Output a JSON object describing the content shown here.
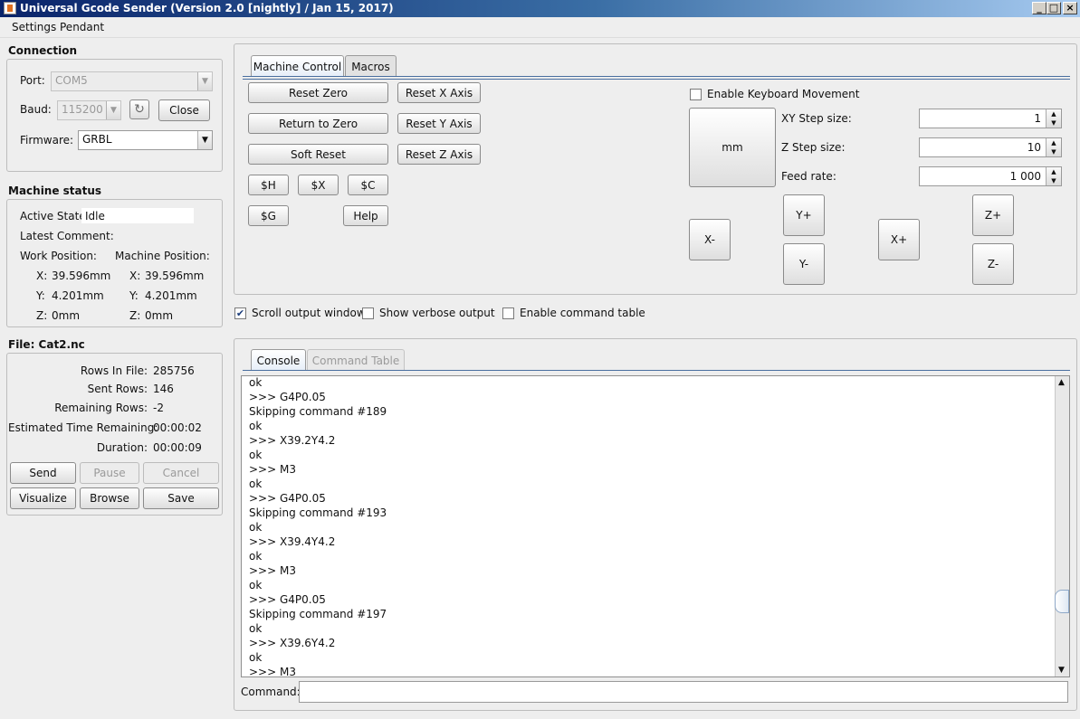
{
  "window": {
    "title": "Universal Gcode Sender (Version 2.0 [nightly]  / Jan 15, 2017)"
  },
  "menu": [
    "Settings",
    "Pendant"
  ],
  "connection": {
    "title": "Connection",
    "port_label": "Port:",
    "port_value": "COM5",
    "baud_label": "Baud:",
    "baud_value": "115200",
    "close_label": "Close",
    "firmware_label": "Firmware:",
    "firmware_value": "GRBL"
  },
  "machine_status": {
    "title": "Machine status",
    "active_state_label": "Active State:",
    "active_state_value": "Idle",
    "latest_comment_label": "Latest Comment:",
    "work_position_label": "Work Position:",
    "machine_position_label": "Machine Position:",
    "work": {
      "x_label": "X:",
      "x": "39.596mm",
      "y_label": "Y:",
      "y": "4.201mm",
      "z_label": "Z:",
      "z": "0mm"
    },
    "machine": {
      "x_label": "X:",
      "x": "39.596mm",
      "y_label": "Y:",
      "y": "4.201mm",
      "z_label": "Z:",
      "z": "0mm"
    }
  },
  "file": {
    "title": "File: Cat2.nc",
    "rows_in_file_label": "Rows In File:",
    "rows_in_file": "285756",
    "sent_rows_label": "Sent Rows:",
    "sent_rows": "146",
    "remaining_rows_label": "Remaining Rows:",
    "remaining_rows": "-2",
    "est_time_label": "Estimated Time Remaining:",
    "est_time": "00:00:02",
    "duration_label": "Duration:",
    "duration": "00:00:09",
    "buttons": {
      "send": "Send",
      "pause": "Pause",
      "cancel": "Cancel",
      "visualize": "Visualize",
      "browse": "Browse",
      "save": "Save"
    }
  },
  "control_tabs": {
    "machine_control": "Machine Control",
    "macros": "Macros"
  },
  "machine_control": {
    "reset_zero": "Reset Zero",
    "return_to_zero": "Return to Zero",
    "soft_reset": "Soft Reset",
    "reset_x": "Reset X Axis",
    "reset_y": "Reset Y Axis",
    "reset_z": "Reset Z Axis",
    "home": "$H",
    "unlock": "$X",
    "check": "$C",
    "gcode_state": "$G",
    "help": "Help"
  },
  "jog": {
    "enable_keyboard_label": "Enable Keyboard Movement",
    "enable_keyboard_checked": false,
    "units_button": "mm",
    "xy_step_label": "XY Step size:",
    "xy_step": "1",
    "z_step_label": "Z Step size:",
    "z_step": "10",
    "feed_rate_label": "Feed rate:",
    "feed_rate": "1 000",
    "x_minus": "X-",
    "x_plus": "X+",
    "y_plus": "Y+",
    "y_minus": "Y-",
    "z_plus": "Z+",
    "z_minus": "Z-"
  },
  "options": {
    "scroll_output_label": "Scroll output window",
    "scroll_output_checked": true,
    "verbose_label": "Show verbose output",
    "verbose_checked": false,
    "command_table_label": "Enable command table",
    "command_table_checked": false
  },
  "console_tabs": {
    "console": "Console",
    "command_table": "Command Table"
  },
  "console_lines": [
    "ok",
    ">>> G4P0.05",
    "Skipping command #189",
    "ok",
    ">>> X39.2Y4.2",
    "ok",
    ">>> M3",
    "ok",
    ">>> G4P0.05",
    "Skipping command #193",
    "ok",
    ">>> X39.4Y4.2",
    "ok",
    ">>> M3",
    "ok",
    ">>> G4P0.05",
    "Skipping command #197",
    "ok",
    ">>> X39.6Y4.2",
    "ok",
    ">>> M3"
  ],
  "command": {
    "label": "Command:",
    "value": ""
  }
}
